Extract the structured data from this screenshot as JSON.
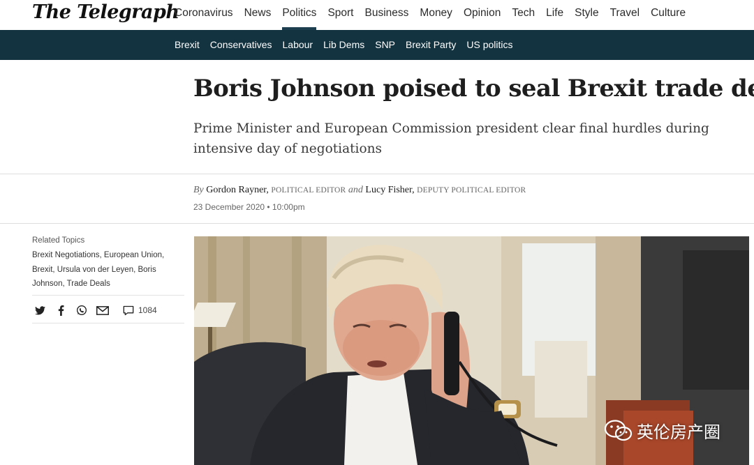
{
  "brand": {
    "logo_text": "The Telegraph"
  },
  "main_nav": {
    "items": [
      {
        "label": "Coronavirus"
      },
      {
        "label": "News"
      },
      {
        "label": "Politics",
        "active": true
      },
      {
        "label": "Sport"
      },
      {
        "label": "Business"
      },
      {
        "label": "Money"
      },
      {
        "label": "Opinion"
      },
      {
        "label": "Tech"
      },
      {
        "label": "Life"
      },
      {
        "label": "Style"
      },
      {
        "label": "Travel"
      },
      {
        "label": "Culture"
      }
    ]
  },
  "sub_nav": {
    "items": [
      {
        "label": "Brexit"
      },
      {
        "label": "Conservatives"
      },
      {
        "label": "Labour"
      },
      {
        "label": "Lib Dems"
      },
      {
        "label": "SNP"
      },
      {
        "label": "Brexit Party"
      },
      {
        "label": "US politics"
      }
    ]
  },
  "article": {
    "headline": "Boris Johnson poised to seal Brexit trade deal",
    "standfirst": "Prime Minister and European Commission president clear final hurdles during intensive day of negotiations",
    "byline": {
      "by": "By",
      "author1": "Gordon Rayner,",
      "role1": "Political Editor",
      "and": "and",
      "author2": "Lucy Fisher,",
      "role2": "Deputy Political Editor"
    },
    "date": "23 December 2020 • 10:00pm"
  },
  "sidebar": {
    "related_title": "Related Topics",
    "related_text": "Brexit Negotiations, European Union, Brexit, Ursula von der Leyen, Boris Johnson, Trade Deals",
    "share_icons": [
      "twitter-icon",
      "facebook-icon",
      "whatsapp-icon",
      "email-icon"
    ],
    "comment_count": "1084"
  },
  "watermark": {
    "text": "英伦房产圈"
  },
  "colors": {
    "nav_dark": "#133340",
    "active_underline": "#1d3e4f"
  }
}
